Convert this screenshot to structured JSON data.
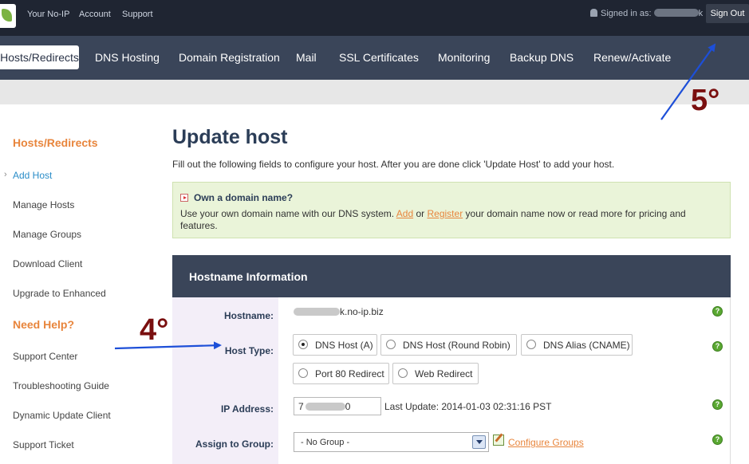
{
  "topbar": {
    "links": [
      "Your No-IP",
      "Account",
      "Support"
    ],
    "signed_in_label": "Signed in as:",
    "signed_in_suffix": "k",
    "sign_out": "Sign Out"
  },
  "nav": {
    "items": [
      "Hosts/Redirects",
      "DNS Hosting",
      "Domain Registration",
      "Mail",
      "SSL Certificates",
      "Monitoring",
      "Backup DNS",
      "Renew/Activate"
    ]
  },
  "sidebar": {
    "section1": "Hosts/Redirects",
    "items1": [
      "Add Host",
      "Manage Hosts",
      "Manage Groups",
      "Download Client",
      "Upgrade to Enhanced"
    ],
    "section2": "Need Help?",
    "items2": [
      "Support Center",
      "Troubleshooting Guide",
      "Dynamic Update Client",
      "Support Ticket"
    ]
  },
  "main": {
    "title": "Update host",
    "intro": "Fill out the following fields to configure your host. After you are done click 'Update Host' to add your host.",
    "domain": {
      "title": "Own a domain name?",
      "text_before": "Use your own domain name with our DNS system.",
      "add_link": "Add",
      "or": "or",
      "register_link": "Register",
      "text_after": "your domain name now or read more for pricing and features."
    },
    "panel_title": "Hostname Information",
    "hostname_label": "Hostname:",
    "hostname_value_suffix": "k.no-ip.biz",
    "host_type_label": "Host Type:",
    "host_types": [
      "DNS Host (A)",
      "DNS Host (Round Robin)",
      "DNS Alias (CNAME)",
      "Port 80 Redirect",
      "Web Redirect"
    ],
    "selected_host_type": "DNS Host (A)",
    "ip_label": "IP Address:",
    "ip_prefix": "7",
    "ip_suffix": "0",
    "last_update": "Last Update: 2014-01-03 02:31:16 PST",
    "group_label": "Assign to Group:",
    "group_value": "- No Group -",
    "configure_groups": "Configure Groups",
    "help_glyph": "?"
  },
  "annotations": {
    "step4": "4°",
    "step5": "5°"
  },
  "colors": {
    "topbar": "#1f2532",
    "nav": "#3a4559",
    "accent_orange": "#e8853c",
    "link_blue": "#2a8dc8",
    "arrow_blue": "#1d4fd8",
    "annotation_red": "#7a0f0f"
  }
}
